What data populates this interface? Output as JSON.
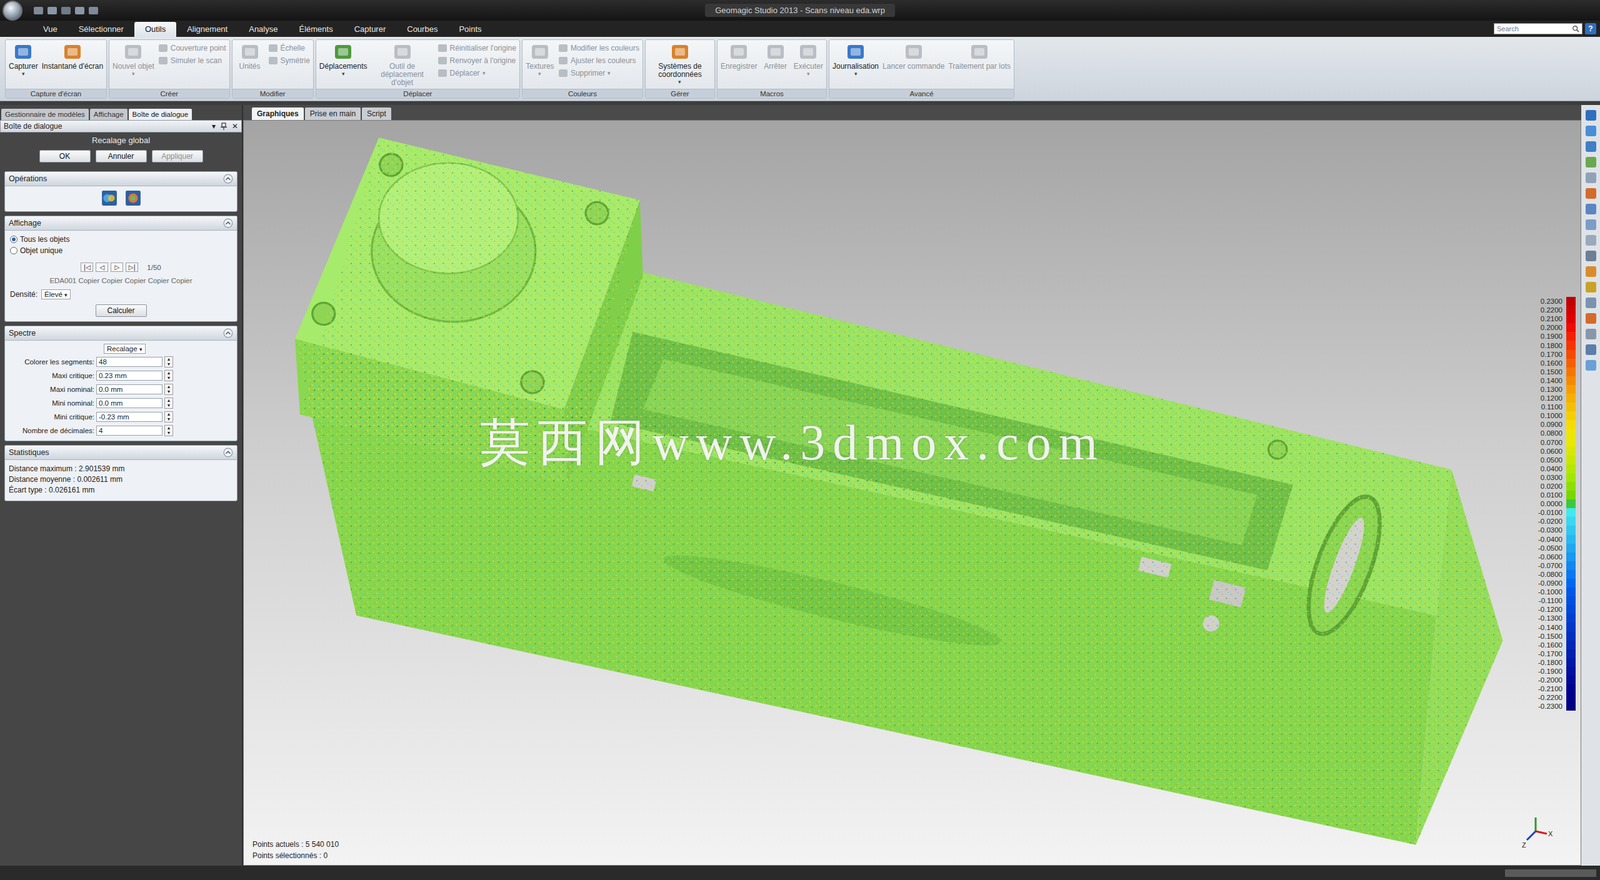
{
  "window": {
    "title": "Geomagic Studio 2013 - Scans niveau eda.wrp"
  },
  "menu_tabs": [
    {
      "label": "Vue",
      "selected": false
    },
    {
      "label": "Sélectionner",
      "selected": false
    },
    {
      "label": "Outils",
      "selected": true
    },
    {
      "label": "Alignement",
      "selected": false
    },
    {
      "label": "Analyse",
      "selected": false
    },
    {
      "label": "Éléments",
      "selected": false
    },
    {
      "label": "Capturer",
      "selected": false
    },
    {
      "label": "Courbes",
      "selected": false
    },
    {
      "label": "Points",
      "selected": false
    }
  ],
  "search": {
    "placeholder": "Search"
  },
  "help_button": "?",
  "ribbon_groups": [
    {
      "label": "Capture d'écran",
      "items": [
        {
          "kind": "large",
          "label": "Capturer",
          "disabled": false,
          "arrow": "▾"
        },
        {
          "kind": "large",
          "label": "Instantané d'écran",
          "disabled": false
        }
      ]
    },
    {
      "label": "Créer",
      "items": [
        {
          "kind": "large",
          "label": "Nouvel objet",
          "disabled": true,
          "arrow": "▾"
        },
        {
          "kind": "stack",
          "items": [
            {
              "label": "Couverture point",
              "disabled": true
            },
            {
              "label": "Simuler le scan",
              "disabled": true
            }
          ]
        }
      ]
    },
    {
      "label": "Modifier",
      "items": [
        {
          "kind": "large",
          "label": "Unités",
          "disabled": true
        },
        {
          "kind": "stack",
          "items": [
            {
              "label": "Échelle",
              "disabled": true
            },
            {
              "label": "Symétrie",
              "disabled": true
            }
          ]
        }
      ]
    },
    {
      "label": "Déplacer",
      "items": [
        {
          "kind": "large",
          "label": "Déplacements",
          "disabled": false,
          "arrow": "▾"
        },
        {
          "kind": "large",
          "label": "Outil de déplacement d'objet",
          "disabled": true
        },
        {
          "kind": "stack",
          "items": [
            {
              "label": "Réinitialiser l'origine",
              "disabled": true
            },
            {
              "label": "Renvoyer à l'origine",
              "disabled": true
            },
            {
              "label": "Déplacer",
              "disabled": true,
              "arrow": "▾"
            }
          ]
        }
      ]
    },
    {
      "label": "Couleurs",
      "items": [
        {
          "kind": "large",
          "label": "Textures",
          "disabled": true,
          "arrow": "▾"
        },
        {
          "kind": "stack",
          "items": [
            {
              "label": "Modifier les couleurs",
              "disabled": true
            },
            {
              "label": "Ajuster les couleurs",
              "disabled": true
            },
            {
              "label": "Supprimer",
              "disabled": true,
              "arrow": "▾"
            }
          ]
        }
      ]
    },
    {
      "label": "Gérer",
      "items": [
        {
          "kind": "large",
          "label": "Systèmes de coordonnées",
          "disabled": false,
          "arrow": "▾"
        }
      ]
    },
    {
      "label": "Macros",
      "items": [
        {
          "kind": "large",
          "label": "Enregistrer",
          "disabled": true
        },
        {
          "kind": "large",
          "label": "Arrêter",
          "disabled": true
        },
        {
          "kind": "large",
          "label": "Exécuter",
          "disabled": true,
          "arrow": "▾"
        }
      ]
    },
    {
      "label": "Avancé",
      "items": [
        {
          "kind": "large",
          "label": "Journalisation",
          "disabled": false,
          "arrow": "▾"
        },
        {
          "kind": "large",
          "label": "Lancer commande",
          "disabled": true
        },
        {
          "kind": "large",
          "label": "Traitement par lots",
          "disabled": true
        }
      ]
    }
  ],
  "left_tabs": [
    {
      "label": "Gestionnaire de modèles",
      "selected": false
    },
    {
      "label": "Affichage",
      "selected": false
    },
    {
      "label": "Boîte de dialogue",
      "selected": true
    }
  ],
  "dialog": {
    "header": "Boîte de dialogue",
    "header_buttons": [
      "▾",
      "✕"
    ],
    "title": "Recalage global",
    "buttons": [
      {
        "label": "OK",
        "disabled": false
      },
      {
        "label": "Annuler",
        "disabled": false
      },
      {
        "label": "Appliquer",
        "disabled": true
      }
    ],
    "operations": {
      "title": "Opérations",
      "expanded": true
    },
    "affichage": {
      "title": "Affichage",
      "expanded": true,
      "radios": [
        {
          "label": "Tous les objets",
          "selected": true
        },
        {
          "label": "Objet unique",
          "selected": false
        }
      ],
      "nav": [
        "|◁",
        "◁",
        "▷",
        "▷|"
      ],
      "counter": "1/50",
      "object": "EDA001 Copier Copier Copier Copier Copier",
      "density_label": "Densité:",
      "density_value": "Élevé",
      "arrow": "▾",
      "compute": "Calculer"
    },
    "spectre": {
      "title": "Spectre",
      "expanded": true,
      "mode": "Recalage",
      "arrow": "▾",
      "spinner": [
        "▴",
        "▾"
      ],
      "fields": [
        {
          "label": "Colorer les segments:",
          "value": "48"
        },
        {
          "label": "Maxi critique:",
          "value": "0.23 mm"
        },
        {
          "label": "Maxi nominal:",
          "value": "0.0 mm"
        },
        {
          "label": "Mini nominal:",
          "value": "0.0 mm"
        },
        {
          "label": "Mini critique:",
          "value": "-0.23 mm"
        },
        {
          "label": "Nombre de décimales:",
          "value": "4"
        }
      ]
    },
    "statistiques": {
      "title": "Statistiques",
      "expanded": true,
      "lines": [
        "Distance maximum : 2.901539 mm",
        "Distance moyenne : 0.002611 mm",
        "Écart type : 0.026161 mm"
      ]
    }
  },
  "viewport": {
    "tabs": [
      {
        "label": "Graphiques",
        "selected": true
      },
      {
        "label": "Prise en main",
        "selected": false
      },
      {
        "label": "Script",
        "selected": false
      }
    ],
    "watermark": "莫西网www.3dmox.com",
    "status_lines": [
      "Points actuels : 5 540 010",
      "Points sélectionnés : 0"
    ],
    "axes": [
      "X",
      "Z"
    ],
    "legend": [
      {
        "value": "0.2300",
        "color": "#c00000"
      },
      {
        "value": "0.2200",
        "color": "#d00000"
      },
      {
        "value": "0.2100",
        "color": "#e00000"
      },
      {
        "value": "0.2000",
        "color": "#f00a00"
      },
      {
        "value": "0.1900",
        "color": "#f52000"
      },
      {
        "value": "0.1800",
        "color": "#f53500"
      },
      {
        "value": "0.1700",
        "color": "#f54a00"
      },
      {
        "value": "0.1600",
        "color": "#f56000"
      },
      {
        "value": "0.1500",
        "color": "#f57500"
      },
      {
        "value": "0.1400",
        "color": "#f58a00"
      },
      {
        "value": "0.1300",
        "color": "#f5a000"
      },
      {
        "value": "0.1200",
        "color": "#f5b000"
      },
      {
        "value": "0.1100",
        "color": "#f5c000"
      },
      {
        "value": "0.1000",
        "color": "#f5cf00"
      },
      {
        "value": "0.0900",
        "color": "#f5dc00"
      },
      {
        "value": "0.0800",
        "color": "#f0e400"
      },
      {
        "value": "0.0700",
        "color": "#e8e800"
      },
      {
        "value": "0.0600",
        "color": "#d8e800"
      },
      {
        "value": "0.0500",
        "color": "#c8e800"
      },
      {
        "value": "0.0400",
        "color": "#b4e800"
      },
      {
        "value": "0.0300",
        "color": "#a0e800"
      },
      {
        "value": "0.0200",
        "color": "#8ce000"
      },
      {
        "value": "0.0100",
        "color": "#78d800"
      },
      {
        "value": "0.0000",
        "color": "#3cc83c"
      },
      {
        "value": "-0.0100",
        "color": "#40e8f0"
      },
      {
        "value": "-0.0200",
        "color": "#38d8f0"
      },
      {
        "value": "-0.0300",
        "color": "#30c8f0"
      },
      {
        "value": "-0.0400",
        "color": "#28b8f0"
      },
      {
        "value": "-0.0500",
        "color": "#20a8f0"
      },
      {
        "value": "-0.0600",
        "color": "#1898f0"
      },
      {
        "value": "-0.0700",
        "color": "#1088f0"
      },
      {
        "value": "-0.0800",
        "color": "#0878f0"
      },
      {
        "value": "-0.0900",
        "color": "#0068f0"
      },
      {
        "value": "-0.1000",
        "color": "#0058e8"
      },
      {
        "value": "-0.1100",
        "color": "#0050e0"
      },
      {
        "value": "-0.1200",
        "color": "#0048d8"
      },
      {
        "value": "-0.1300",
        "color": "#0040d0"
      },
      {
        "value": "-0.1400",
        "color": "#0038c8"
      },
      {
        "value": "-0.1500",
        "color": "#0030c0"
      },
      {
        "value": "-0.1600",
        "color": "#0028b8"
      },
      {
        "value": "-0.1700",
        "color": "#0020b0"
      },
      {
        "value": "-0.1800",
        "color": "#0018a8"
      },
      {
        "value": "-0.1900",
        "color": "#0010a0"
      },
      {
        "value": "-0.2000",
        "color": "#000898"
      },
      {
        "value": "-0.2100",
        "color": "#000090"
      },
      {
        "value": "-0.2200",
        "color": "#000088"
      },
      {
        "value": "-0.2300",
        "color": "#000080"
      }
    ]
  }
}
